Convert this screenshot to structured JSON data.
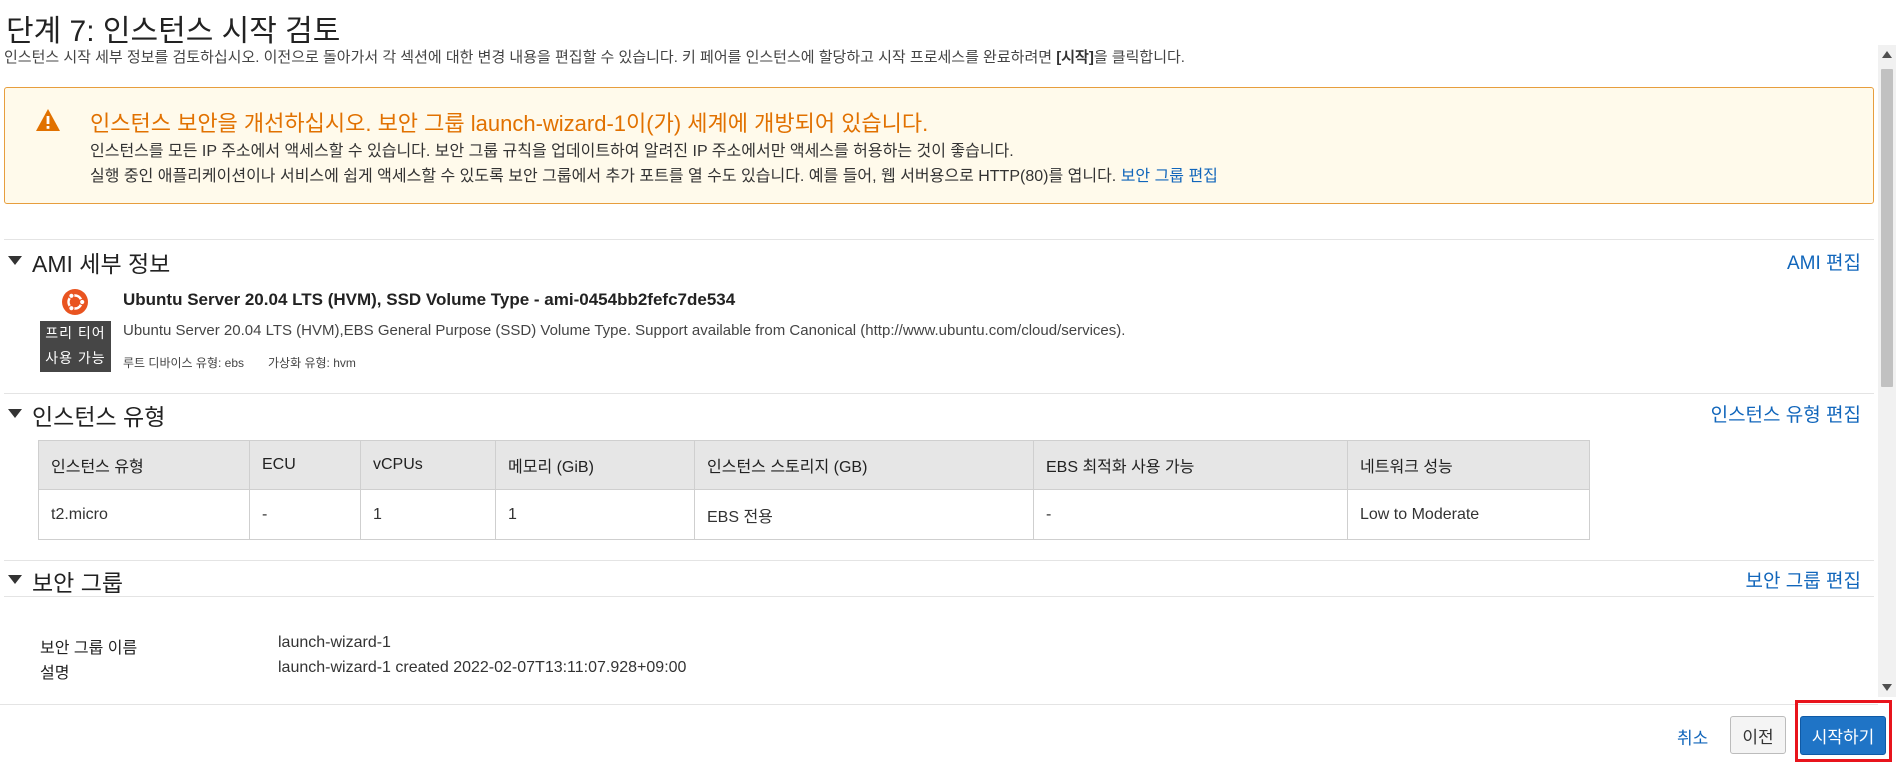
{
  "page": {
    "title": "단계 7: 인스턴스 시작 검토",
    "description_before": "인스턴스 시작 세부 정보를 검토하십시오. 이전으로 돌아가서 각 섹션에 대한 변경 내용을 편집할 수 있습니다. 키 페어를 인스턴스에 할당하고 시작 프로세스를 완료하려면 ",
    "description_bold": "[시작]",
    "description_after": "을 클릭합니다."
  },
  "warning": {
    "title": "인스턴스 보안을 개선하십시오. 보안 그룹 launch-wizard-1이(가) 세계에 개방되어 있습니다.",
    "line1": "인스턴스를 모든 IP 주소에서 액세스할 수 있습니다. 보안 그룹 규칙을 업데이트하여 알려진 IP 주소에서만 액세스를 허용하는 것이 좋습니다.",
    "line2": "실행 중인 애플리케이션이나 서비스에 쉽게 액세스할 수 있도록 보안 그룹에서 추가 포트를 열 수도 있습니다. 예를 들어, 웹 서버용으로 HTTP(80)를 엽니다.",
    "link": "보안 그룹 편집",
    "icon": "warning-triangle-icon",
    "color": "#e17100"
  },
  "ami": {
    "section_title": "AMI 세부 정보",
    "edit_link": "AMI 편집",
    "logo_icon": "ubuntu-logo-icon",
    "badge_line1": "프리 티어",
    "badge_line2": "사용 가능",
    "name": "Ubuntu Server 20.04 LTS (HVM), SSD Volume Type - ami-0454bb2fefc7de534",
    "description": "Ubuntu Server 20.04 LTS (HVM),EBS General Purpose (SSD) Volume Type. Support available from Canonical (http://www.ubuntu.com/cloud/services).",
    "root_device": "루트 디바이스 유형: ebs",
    "virtualization": "가상화 유형: hvm"
  },
  "instance_type": {
    "section_title": "인스턴스 유형",
    "edit_link": "인스턴스 유형 편집",
    "headers": [
      "인스턴스 유형",
      "ECU",
      "vCPUs",
      "메모리 (GiB)",
      "인스턴스 스토리지 (GB)",
      "EBS 최적화 사용 가능",
      "네트워크 성능"
    ],
    "row": [
      "t2.micro",
      "-",
      "1",
      "1",
      "EBS 전용",
      "-",
      "Low to Moderate"
    ]
  },
  "security_group": {
    "section_title": "보안 그룹",
    "edit_link": "보안 그룹 편집",
    "name_label": "보안 그룹 이름",
    "name_value": "launch-wizard-1",
    "desc_label": "설명",
    "desc_value": "launch-wizard-1 created 2022-02-07T13:11:07.928+09:00"
  },
  "footer": {
    "cancel": "취소",
    "previous": "이전",
    "launch": "시작하기"
  },
  "colors": {
    "link": "#1166bb",
    "primary_button": "#1f74c6",
    "highlight": "#e8141c",
    "warning_bg": "#fffaeb"
  }
}
